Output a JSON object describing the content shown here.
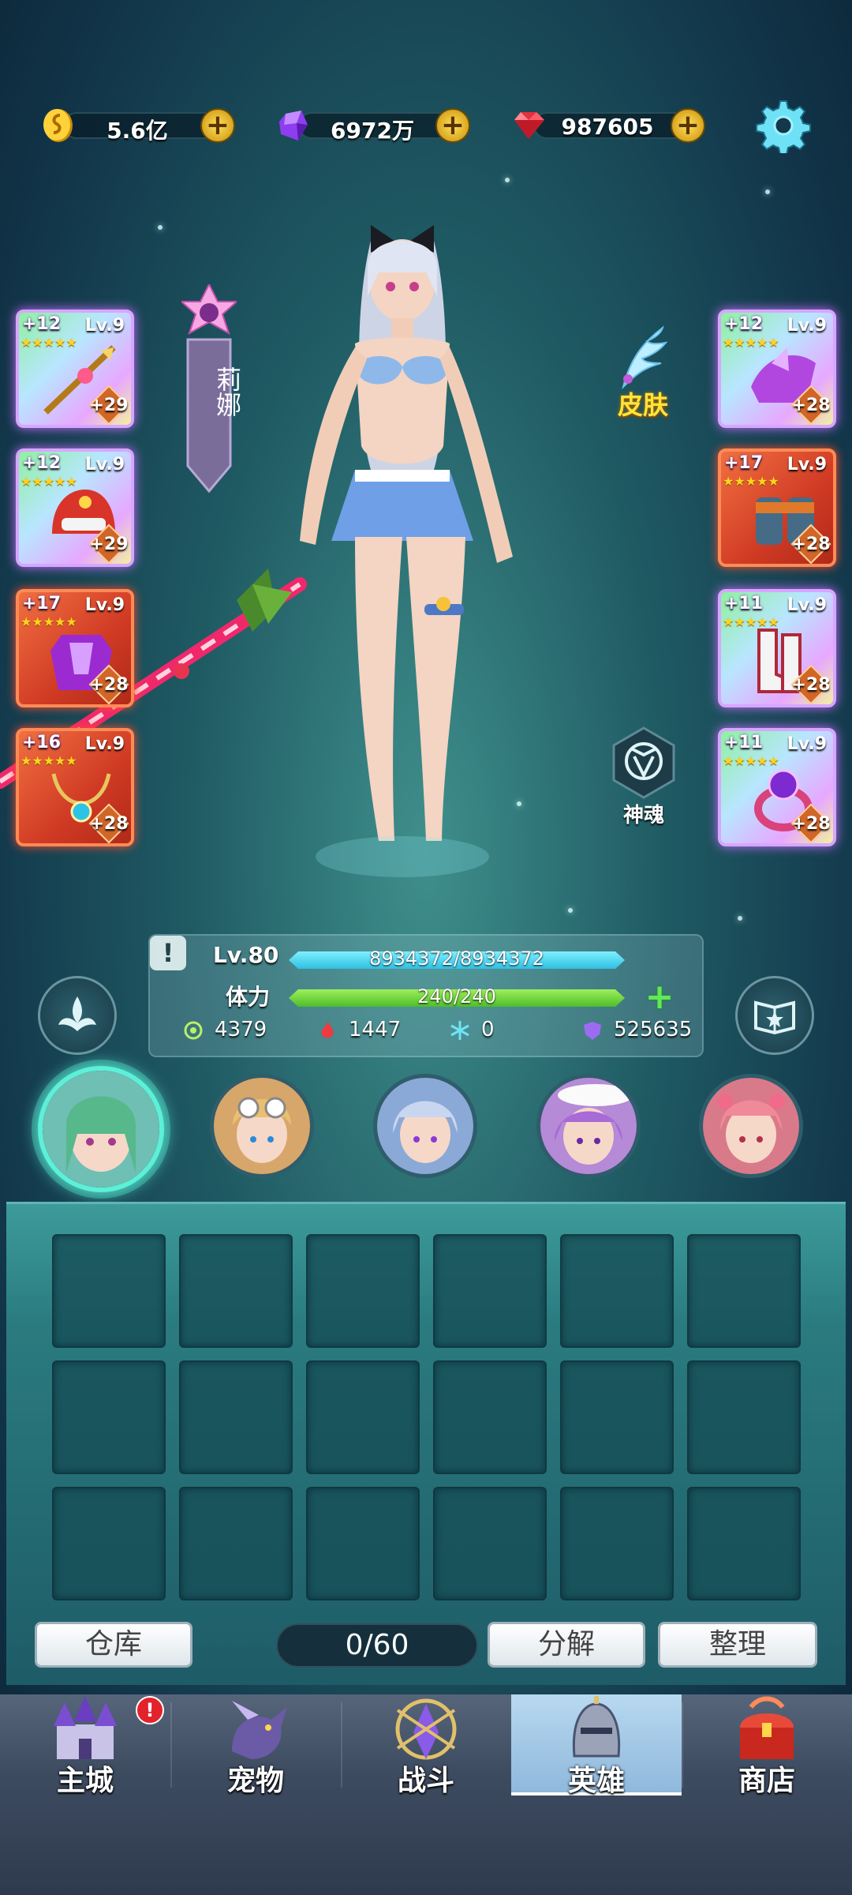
{
  "currencies": {
    "gold": "5.6亿",
    "crystal": "6972万",
    "ruby": "987605"
  },
  "hero": {
    "name": "莉娜",
    "skin_label": "皮肤",
    "soul_label": "神魂"
  },
  "equipment": {
    "left": [
      {
        "plus": "+12",
        "level": "Lv.9",
        "bonus": "+29"
      },
      {
        "plus": "+12",
        "level": "Lv.9",
        "bonus": "+29"
      },
      {
        "plus": "+17",
        "level": "Lv.9",
        "bonus": "+28"
      },
      {
        "plus": "+16",
        "level": "Lv.9",
        "bonus": "+28"
      }
    ],
    "right": [
      {
        "plus": "+12",
        "level": "Lv.9",
        "bonus": "+28"
      },
      {
        "plus": "+17",
        "level": "Lv.9",
        "bonus": "+28"
      },
      {
        "plus": "+11",
        "level": "Lv.9",
        "bonus": "+28"
      },
      {
        "plus": "+11",
        "level": "Lv.9",
        "bonus": "+28"
      }
    ]
  },
  "stats": {
    "warn": "!",
    "level": "Lv.80",
    "hp_text": "8934372/8934372",
    "hp_fraction": 1.0,
    "stamina_label": "体力",
    "stamina_text": "240/240",
    "stamina_fraction": 1.0,
    "attack": "4379",
    "fire": "1447",
    "ice": "0",
    "power": "525635"
  },
  "inventory": {
    "count": "0/60",
    "warehouse_label": "仓库",
    "decompose_label": "分解",
    "sort_label": "整理"
  },
  "nav": [
    {
      "label": "主城",
      "badge": "!"
    },
    {
      "label": "宠物"
    },
    {
      "label": "战斗"
    },
    {
      "label": "英雄"
    },
    {
      "label": "商店"
    }
  ],
  "colors": {
    "accent": "#5cf0d8",
    "hp_bar": "#2fbfe2",
    "stamina_bar": "#4ebd2a",
    "skin_label": "#ffe53a"
  }
}
